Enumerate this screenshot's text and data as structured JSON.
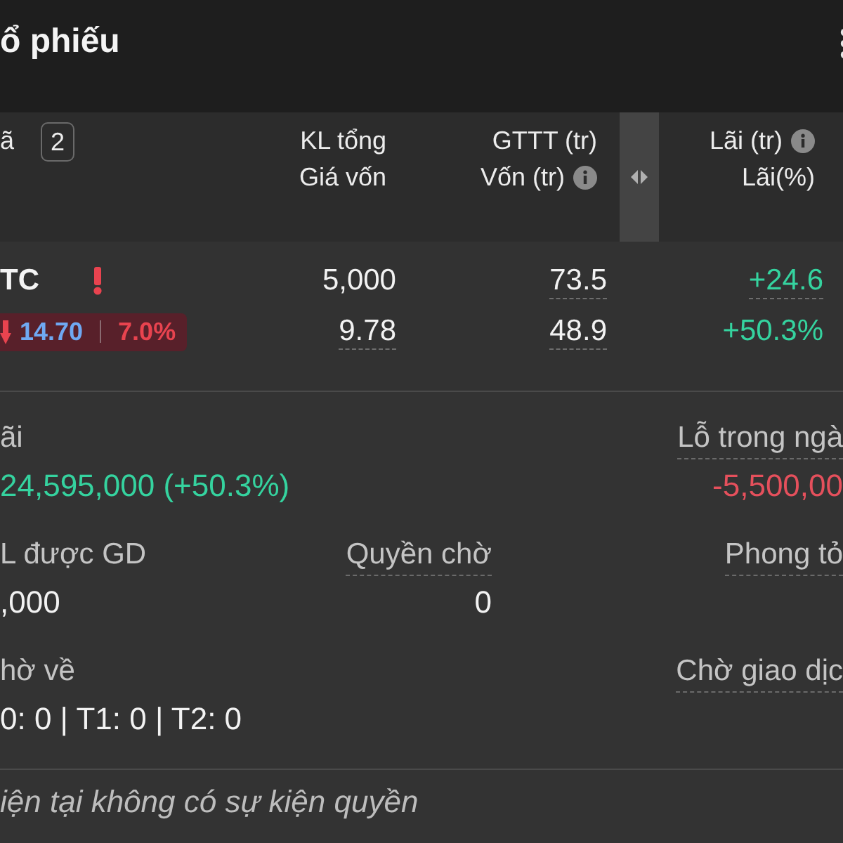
{
  "header": {
    "title": "ổ phiếu"
  },
  "table": {
    "symbol_header": "ã",
    "count_badge": "2",
    "columns": [
      {
        "lines": [
          {
            "text": "KL tổng",
            "info": false
          },
          {
            "text": "Giá vốn",
            "info": false
          }
        ]
      },
      {
        "lines": [
          {
            "text": "GTTT (tr)",
            "info": false
          },
          {
            "text": "Vốn (tr)",
            "info": true
          }
        ]
      },
      {
        "lines": [
          {
            "text": "Lãi (tr)",
            "info": true
          },
          {
            "text": "Lãi(%)",
            "info": false
          }
        ]
      }
    ],
    "rows": [
      {
        "symbol": "TC",
        "warning": true,
        "falling": true,
        "price": "14.70",
        "change": "7.0%",
        "cells": [
          [
            {
              "text": "5,000",
              "color": "#f2f2f2",
              "underlined": false
            },
            {
              "text": "9.78",
              "color": "#f2f2f2",
              "underlined": true
            }
          ],
          [
            {
              "text": "73.5",
              "color": "#f2f2f2",
              "underlined": true
            },
            {
              "text": "48.9",
              "color": "#f2f2f2",
              "underlined": true
            }
          ],
          [
            {
              "text": "+24.6",
              "color": "#35d39f",
              "underlined": true
            },
            {
              "text": "+50.3%",
              "color": "#35d39f",
              "underlined": false
            }
          ]
        ]
      }
    ]
  },
  "summary": {
    "rows": [
      {
        "items": [
          {
            "label": "ãi",
            "underlined": false,
            "value": "24,595,000 (+50.3%)",
            "color": "#35d39f"
          },
          {
            "label": "Lỗ trong ngà",
            "underlined": true,
            "value": "-5,500,00",
            "color": "#e5505c"
          }
        ]
      },
      {
        "items": [
          {
            "label": "L được GD",
            "underlined": false,
            "value": ",000",
            "color": "#f2f2f2"
          },
          {
            "label": "Quyền chờ",
            "underlined": true,
            "value": "0",
            "color": "#f2f2f2"
          },
          {
            "label": "Phong tỏ",
            "underlined": true
          }
        ]
      },
      {
        "items": [
          {
            "label": "hờ về",
            "underlined": false,
            "value": "0: 0 | T1: 0 | T2: 0",
            "color": "#f2f2f2"
          },
          {
            "label": "Chờ giao dịc",
            "underlined": true
          }
        ]
      }
    ]
  },
  "events_note": "iện tại không có sự kiện quyền"
}
